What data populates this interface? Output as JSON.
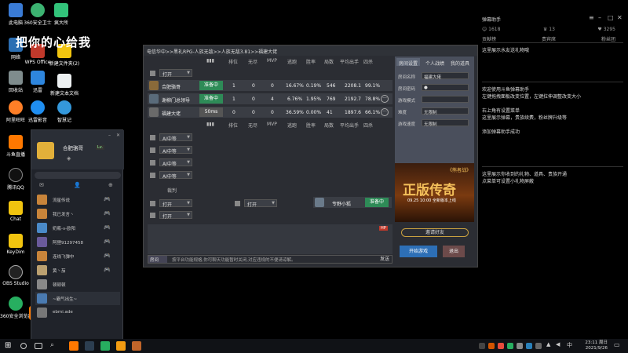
{
  "desktop": {
    "icons": [
      {
        "label": "此电脑"
      },
      {
        "label": "360安全卫士"
      },
      {
        "label": "疯大所"
      },
      {
        "label": "网络"
      },
      {
        "label": "WPS Office"
      },
      {
        "label": "新建文件夹(2)"
      },
      {
        "label": "回收站"
      },
      {
        "label": "迅雷"
      },
      {
        "label": "新建文本文档"
      },
      {
        "label": "阿里旺旺"
      },
      {
        "label": "迅雷影音"
      },
      {
        "label": "智慧记"
      },
      {
        "label": "斗鱼直播"
      },
      {
        "label": "腾讯QQ"
      },
      {
        "label": "Chat"
      },
      {
        "label": "KeyDim"
      },
      {
        "label": "OBS Studio"
      },
      {
        "label": "360安全浏览器"
      },
      {
        "label": "斗鱼"
      }
    ],
    "overlay_text": "把你的心给我"
  },
  "right_panel": {
    "title": "弹幕助手",
    "stats": [
      "1618",
      "13",
      "3295"
    ],
    "tabs": [
      "贡献榜",
      "贵宾席",
      "粉丝团"
    ],
    "messages": [
      "这里展示水友送礼物哦",
      "欢迎使用斗鱼弹幕助手",
      "左键拖拽面板改变位置，左键拉伸调整改变大小",
      "右上角有设置菜单",
      "这里展示弹幕，贵族续费，粉丝牌升级等",
      "添加弹幕助手成功",
      "这里展示你收到的礼物、道具、贵族开通",
      "点菜单可设置小礼物屏蔽"
    ]
  },
  "app": {
    "title": "电信华中>>黑礼RPG-人族无敌>>人族无敌3.81>>福建大佬",
    "headers": [
      "排位",
      "无尽",
      "MVP",
      "逃跑",
      "胜率",
      "局数",
      "平均出手",
      "四杀"
    ],
    "players": [
      {
        "name": "合肥骆哥",
        "status": "准备中",
        "rank": "1",
        "endless": "0",
        "mvp": "0",
        "escape": "16.67%",
        "win": "0.19%",
        "games": "546",
        "avg": "2208.1",
        "quad": "99.1%"
      },
      {
        "name": "谢柳门总领导",
        "status": "准备中",
        "rank": "1",
        "endless": "0",
        "mvp": "4",
        "escape": "6.76%",
        "win": "1.95%",
        "games": "769",
        "avg": "2192.7",
        "quad": "78.8%"
      },
      {
        "name": "福建大佬",
        "status": "50ms",
        "rank": "0",
        "endless": "0",
        "mvp": "0",
        "escape": "36.59%",
        "win": "0.00%",
        "games": "41",
        "avg": "1897.6",
        "quad": "66.1%"
      }
    ],
    "open_label": "打开",
    "ai_label": "AI中等",
    "observer_label": "裁判",
    "host_name": "专野小狐",
    "host_status": "准备中",
    "badge": "HP",
    "config": {
      "tabs": [
        "房间设置",
        "个人战绩",
        "我的道具"
      ],
      "fields": [
        {
          "label": "房间名称",
          "value": "福建大佬"
        },
        {
          "label": "房间密码",
          "value": "●"
        },
        {
          "label": "游戏模式",
          "value": ""
        },
        {
          "label": "难度",
          "value": "无限制"
        },
        {
          "label": "游戏速度",
          "value": "无限制"
        }
      ]
    },
    "banner": {
      "logo": "《熊者战》",
      "title": "正版传奇",
      "sub": "09.25 10:00 全新版本上线"
    },
    "spectate_label": "邀请好友",
    "start_label": "开始游戏",
    "exit_label": "退出",
    "chat_channel": "房间",
    "chat_text": "按平台功能规格,你可聊天功能暂时关闭,对应违规的不便请谅解。",
    "send_label": "发送"
  },
  "friends": {
    "name": "合肥骆哥",
    "level": "Lv.",
    "items": [
      {
        "name": "流星传说"
      },
      {
        "name": "我已发言丶"
      },
      {
        "name": "奶瓶-v-欧阳"
      },
      {
        "name": "阿狸91297458"
      },
      {
        "name": "连线飞弹中"
      },
      {
        "name": "黄丶茄"
      },
      {
        "name": "顿顿顿"
      },
      {
        "name": "~霸气出生~"
      },
      {
        "name": "ebmi.ade"
      }
    ]
  },
  "taskbar": {
    "time": "23:11 周日",
    "date": "2021/9/26"
  }
}
